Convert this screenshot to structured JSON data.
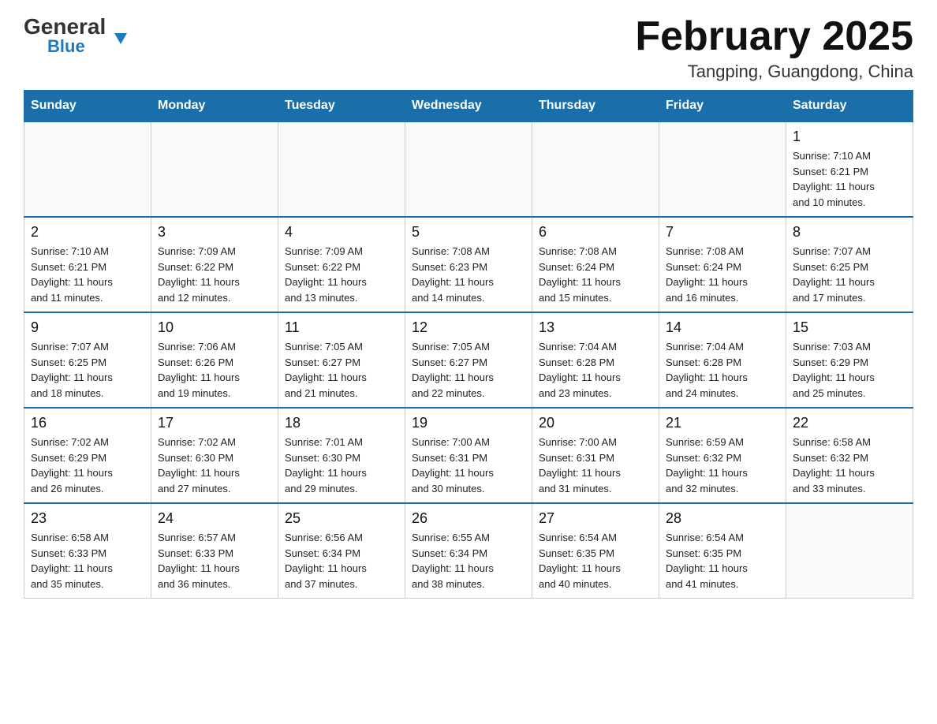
{
  "logo": {
    "general": "General",
    "triangle": "▲",
    "blue": "Blue"
  },
  "title": {
    "month_year": "February 2025",
    "location": "Tangping, Guangdong, China"
  },
  "days_of_week": [
    "Sunday",
    "Monday",
    "Tuesday",
    "Wednesday",
    "Thursday",
    "Friday",
    "Saturday"
  ],
  "weeks": [
    [
      {
        "day": "",
        "info": ""
      },
      {
        "day": "",
        "info": ""
      },
      {
        "day": "",
        "info": ""
      },
      {
        "day": "",
        "info": ""
      },
      {
        "day": "",
        "info": ""
      },
      {
        "day": "",
        "info": ""
      },
      {
        "day": "1",
        "info": "Sunrise: 7:10 AM\nSunset: 6:21 PM\nDaylight: 11 hours\nand 10 minutes."
      }
    ],
    [
      {
        "day": "2",
        "info": "Sunrise: 7:10 AM\nSunset: 6:21 PM\nDaylight: 11 hours\nand 11 minutes."
      },
      {
        "day": "3",
        "info": "Sunrise: 7:09 AM\nSunset: 6:22 PM\nDaylight: 11 hours\nand 12 minutes."
      },
      {
        "day": "4",
        "info": "Sunrise: 7:09 AM\nSunset: 6:22 PM\nDaylight: 11 hours\nand 13 minutes."
      },
      {
        "day": "5",
        "info": "Sunrise: 7:08 AM\nSunset: 6:23 PM\nDaylight: 11 hours\nand 14 minutes."
      },
      {
        "day": "6",
        "info": "Sunrise: 7:08 AM\nSunset: 6:24 PM\nDaylight: 11 hours\nand 15 minutes."
      },
      {
        "day": "7",
        "info": "Sunrise: 7:08 AM\nSunset: 6:24 PM\nDaylight: 11 hours\nand 16 minutes."
      },
      {
        "day": "8",
        "info": "Sunrise: 7:07 AM\nSunset: 6:25 PM\nDaylight: 11 hours\nand 17 minutes."
      }
    ],
    [
      {
        "day": "9",
        "info": "Sunrise: 7:07 AM\nSunset: 6:25 PM\nDaylight: 11 hours\nand 18 minutes."
      },
      {
        "day": "10",
        "info": "Sunrise: 7:06 AM\nSunset: 6:26 PM\nDaylight: 11 hours\nand 19 minutes."
      },
      {
        "day": "11",
        "info": "Sunrise: 7:05 AM\nSunset: 6:27 PM\nDaylight: 11 hours\nand 21 minutes."
      },
      {
        "day": "12",
        "info": "Sunrise: 7:05 AM\nSunset: 6:27 PM\nDaylight: 11 hours\nand 22 minutes."
      },
      {
        "day": "13",
        "info": "Sunrise: 7:04 AM\nSunset: 6:28 PM\nDaylight: 11 hours\nand 23 minutes."
      },
      {
        "day": "14",
        "info": "Sunrise: 7:04 AM\nSunset: 6:28 PM\nDaylight: 11 hours\nand 24 minutes."
      },
      {
        "day": "15",
        "info": "Sunrise: 7:03 AM\nSunset: 6:29 PM\nDaylight: 11 hours\nand 25 minutes."
      }
    ],
    [
      {
        "day": "16",
        "info": "Sunrise: 7:02 AM\nSunset: 6:29 PM\nDaylight: 11 hours\nand 26 minutes."
      },
      {
        "day": "17",
        "info": "Sunrise: 7:02 AM\nSunset: 6:30 PM\nDaylight: 11 hours\nand 27 minutes."
      },
      {
        "day": "18",
        "info": "Sunrise: 7:01 AM\nSunset: 6:30 PM\nDaylight: 11 hours\nand 29 minutes."
      },
      {
        "day": "19",
        "info": "Sunrise: 7:00 AM\nSunset: 6:31 PM\nDaylight: 11 hours\nand 30 minutes."
      },
      {
        "day": "20",
        "info": "Sunrise: 7:00 AM\nSunset: 6:31 PM\nDaylight: 11 hours\nand 31 minutes."
      },
      {
        "day": "21",
        "info": "Sunrise: 6:59 AM\nSunset: 6:32 PM\nDaylight: 11 hours\nand 32 minutes."
      },
      {
        "day": "22",
        "info": "Sunrise: 6:58 AM\nSunset: 6:32 PM\nDaylight: 11 hours\nand 33 minutes."
      }
    ],
    [
      {
        "day": "23",
        "info": "Sunrise: 6:58 AM\nSunset: 6:33 PM\nDaylight: 11 hours\nand 35 minutes."
      },
      {
        "day": "24",
        "info": "Sunrise: 6:57 AM\nSunset: 6:33 PM\nDaylight: 11 hours\nand 36 minutes."
      },
      {
        "day": "25",
        "info": "Sunrise: 6:56 AM\nSunset: 6:34 PM\nDaylight: 11 hours\nand 37 minutes."
      },
      {
        "day": "26",
        "info": "Sunrise: 6:55 AM\nSunset: 6:34 PM\nDaylight: 11 hours\nand 38 minutes."
      },
      {
        "day": "27",
        "info": "Sunrise: 6:54 AM\nSunset: 6:35 PM\nDaylight: 11 hours\nand 40 minutes."
      },
      {
        "day": "28",
        "info": "Sunrise: 6:54 AM\nSunset: 6:35 PM\nDaylight: 11 hours\nand 41 minutes."
      },
      {
        "day": "",
        "info": ""
      }
    ]
  ]
}
